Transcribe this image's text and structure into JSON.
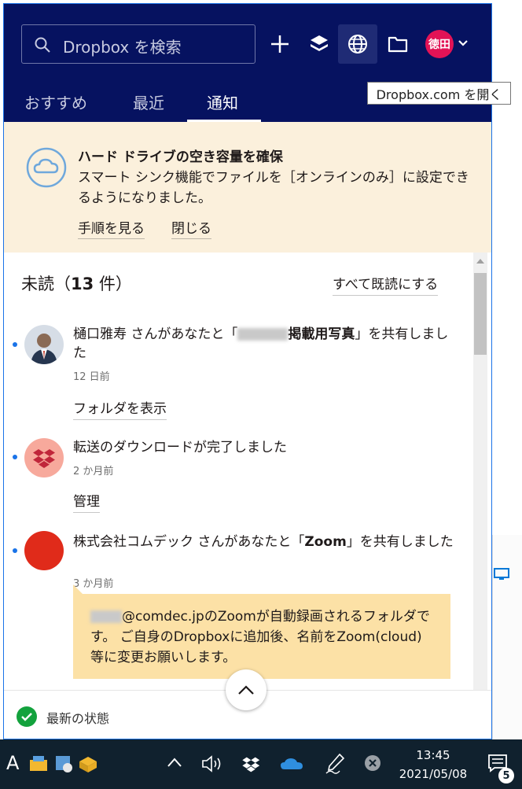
{
  "header": {
    "search_placeholder": "Dropbox を検索",
    "avatar_initials": "徳田",
    "tooltip": "Dropbox.com を開く"
  },
  "tabs": [
    {
      "label": "おすすめ",
      "active": false
    },
    {
      "label": "最近",
      "active": false
    },
    {
      "label": "通知",
      "active": true
    }
  ],
  "banner": {
    "title": "ハード ドライブの空き容量を確保",
    "body": "スマート シンク機能でファイルを［オンラインのみ］に設定できるようになりました。",
    "steps_label": "手順を見る",
    "close_label": "閉じる"
  },
  "unread": {
    "title_prefix": "未読（",
    "count": "13",
    "title_suffix": " 件）",
    "mark_all_label": "すべて既読にする"
  },
  "notifications": [
    {
      "text_prefix": "樋口雅寿 さんがあなたと「",
      "text_bold": "掲載用写真",
      "text_suffix": "」を共有しました",
      "time": "12 日前",
      "action": "フォルダを表示"
    },
    {
      "text": "転送のダウンロードが完了しました",
      "time": "2 か月前",
      "action": "管理"
    },
    {
      "text_prefix": "株式会社コムデック さんがあなたと「",
      "text_bold": "Zoom",
      "text_suffix": "」を共有しました",
      "time": "3 か月前",
      "note": "@comdec.jpのZoomが自動録画されるフォルダです。 ご自身のDropboxに追加後、名前をZoom(cloud)等に変更お願いします。"
    }
  ],
  "status": {
    "text": "最新の状態"
  },
  "taskbar": {
    "ime": "A",
    "time": "13:45",
    "date": "2021/05/08",
    "notification_count": "5"
  },
  "colors": {
    "header_bg": "#061260",
    "banner_bg": "#fbf0dc",
    "accent_blue": "#1a73e8",
    "note_bg": "#fce1a6",
    "avatar_red": "#e21356",
    "status_green": "#13a23d"
  }
}
